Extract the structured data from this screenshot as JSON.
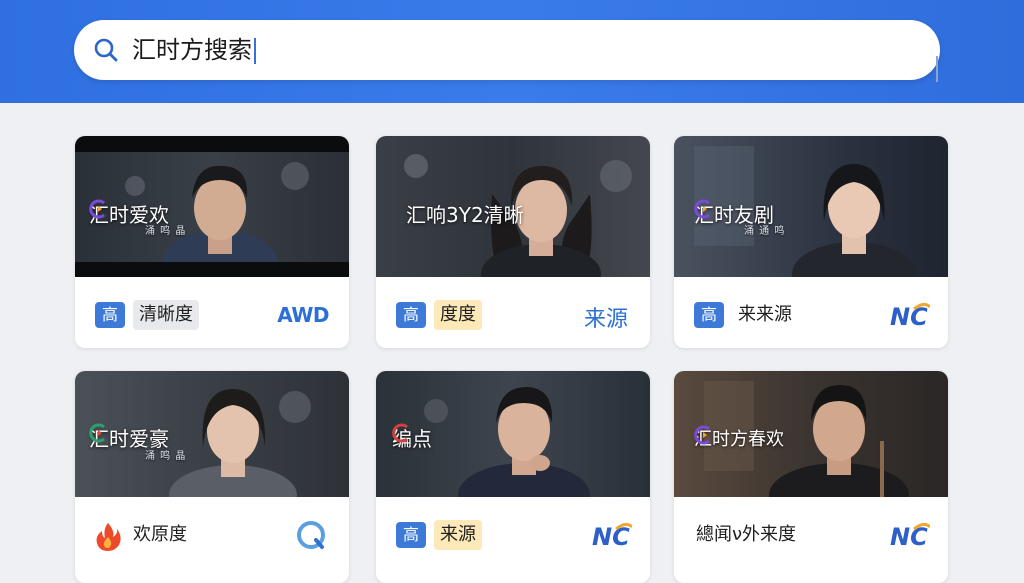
{
  "search": {
    "query": "汇时方搜索"
  },
  "cards": [
    {
      "overlay_title": "汇时爱欢",
      "overlay_sub": "涌 鸣 晶",
      "tag_label": "清晰度",
      "tag_icon": "高",
      "brand": "AWD"
    },
    {
      "overlay_title": "汇响3Y2清晰",
      "tag_label": "度度",
      "tag_icon": "高",
      "brand": "来源"
    },
    {
      "overlay_title": "汇时友剧",
      "overlay_sub": "涌 通 鸣",
      "tag_label": "来来源",
      "tag_icon": "高",
      "brand": "NC"
    },
    {
      "overlay_title": "汇时爱豪",
      "overlay_sub": "涌 鸣 晶",
      "tag_label": "欢原度",
      "tag_icon": "fire-icon",
      "brand": "Q"
    },
    {
      "overlay_title": "编点",
      "tag_label": "来源",
      "tag_icon": "高",
      "brand": "NC"
    },
    {
      "overlay_title": "汇时方春欢",
      "tag_label": "總闻ν外来度",
      "brand": "NC"
    }
  ],
  "colors": {
    "accent": "#2f6fe0",
    "tag_blue": "#3d7ad8",
    "brand_blue": "#2c6fd6"
  }
}
